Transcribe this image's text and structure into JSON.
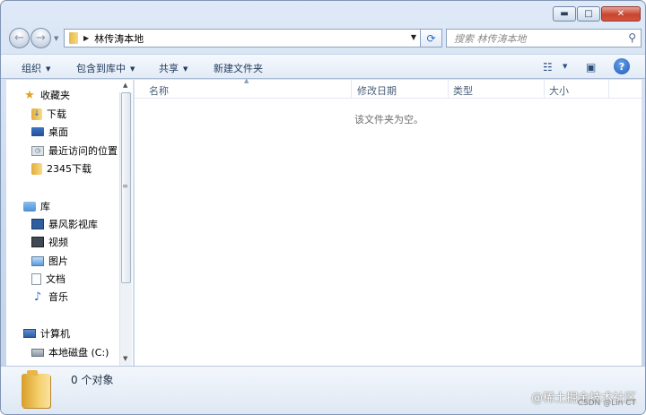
{
  "window": {
    "controls": {
      "minimize": "▬",
      "maximize": "□",
      "close": "✕"
    }
  },
  "nav": {
    "back_icon": "←",
    "forward_icon": "→",
    "address_path": "林传涛本地",
    "search_placeholder": "搜索 林传涛本地"
  },
  "toolbar": {
    "organize": "组织",
    "include_in_library": "包含到库中",
    "share": "共享",
    "new_folder": "新建文件夹",
    "help_glyph": "?"
  },
  "sidebar": {
    "favorites": {
      "label": "收藏夹",
      "items": [
        "下载",
        "桌面",
        "最近访问的位置",
        "2345下载"
      ]
    },
    "libraries": {
      "label": "库",
      "items": [
        "暴风影视库",
        "视频",
        "图片",
        "文档",
        "音乐"
      ]
    },
    "computer": {
      "label": "计算机",
      "items": [
        "本地磁盘 (C:)"
      ]
    }
  },
  "columns": {
    "name": "名称",
    "modified": "修改日期",
    "type": "类型",
    "size": "大小"
  },
  "content": {
    "empty_message": "该文件夹为空。"
  },
  "status": {
    "item_count": "0 个对象"
  },
  "watermark": {
    "main": "@稀土掘金技术社区",
    "sub": "CSDN @Lin CT"
  }
}
